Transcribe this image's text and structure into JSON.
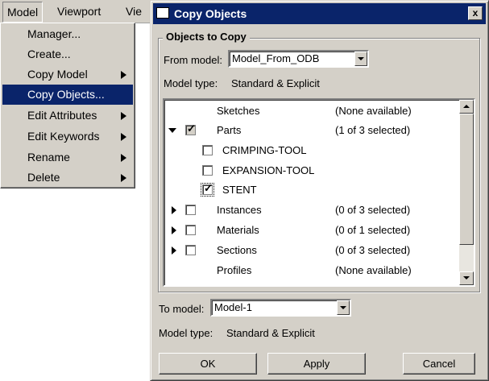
{
  "menubar": {
    "items": [
      {
        "label": "Model"
      },
      {
        "label": "Viewport"
      },
      {
        "label": "Vie"
      }
    ]
  },
  "menu": {
    "items": [
      {
        "label": "Manager...",
        "has_submenu": false
      },
      {
        "label": "Create...",
        "has_submenu": false
      },
      {
        "label": "Copy Model",
        "has_submenu": true
      },
      {
        "label": "Copy Objects...",
        "has_submenu": false,
        "selected": true
      },
      {
        "label": "Edit Attributes",
        "has_submenu": true
      },
      {
        "label": "Edit Keywords",
        "has_submenu": true
      },
      {
        "label": "Rename",
        "has_submenu": true
      },
      {
        "label": "Delete",
        "has_submenu": true
      }
    ]
  },
  "dialog": {
    "title": "Copy Objects",
    "group_title": "Objects to Copy",
    "from_model_label": "From model:",
    "from_model_value": "Model_From_ODB",
    "model_type_label": "Model type:",
    "model_type_value": "Standard & Explicit",
    "tree": [
      {
        "name": "Sketches",
        "status": "(None available)"
      },
      {
        "name": "Parts",
        "status": "(1 of 3 selected)",
        "expanded": true,
        "checked": "partial"
      },
      {
        "name": "CRIMPING-TOOL",
        "status": "",
        "checked": false
      },
      {
        "name": "EXPANSION-TOOL",
        "status": "",
        "checked": false
      },
      {
        "name": "STENT",
        "status": "",
        "checked": true
      },
      {
        "name": "Instances",
        "status": "(0 of 3 selected)",
        "checked": false
      },
      {
        "name": "Materials",
        "status": "(0 of 1 selected)",
        "checked": false
      },
      {
        "name": "Sections",
        "status": "(0 of 3 selected)",
        "checked": false
      },
      {
        "name": "Profiles",
        "status": "(None available)"
      }
    ],
    "to_model_label": "To model:",
    "to_model_value": "Model-1",
    "model_type2_label": "Model type:",
    "model_type2_value": "Standard & Explicit",
    "buttons": {
      "ok": "OK",
      "apply": "Apply",
      "cancel": "Cancel"
    },
    "close_glyph": "x"
  },
  "colors": {
    "selection": "#0a246a",
    "face": "#d4d0c8"
  }
}
